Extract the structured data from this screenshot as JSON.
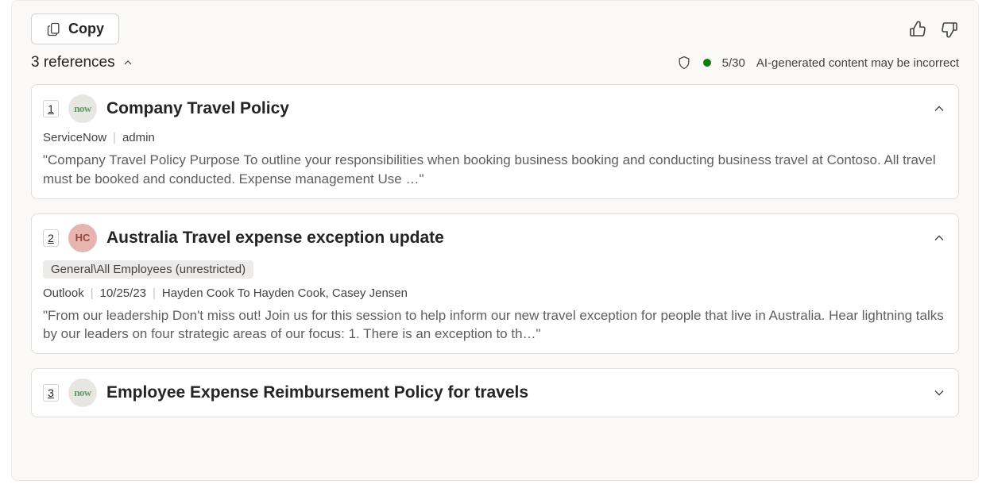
{
  "toolbar": {
    "copy_label": "Copy"
  },
  "references_header": "3 references",
  "status": {
    "count": "5/30",
    "disclaimer": "AI-generated content may be incorrect"
  },
  "references": [
    {
      "index": "1",
      "avatar_kind": "now",
      "avatar_text": "now",
      "title": "Company Travel Policy",
      "expanded": true,
      "source": "ServiceNow",
      "author": "admin",
      "excerpt": "\"Company Travel Policy Purpose To outline your responsibilities when booking business booking and conducting business travel at Contoso. All travel must be booked and conducted. Expense management Use …\""
    },
    {
      "index": "2",
      "avatar_kind": "hc",
      "avatar_text": "HC",
      "title": "Australia Travel expense exception update",
      "expanded": true,
      "tag": "General\\All Employees (unrestricted)",
      "source": "Outlook",
      "date": "10/25/23",
      "author_line": "Hayden Cook To Hayden Cook, Casey Jensen",
      "excerpt": "\"From our leadership Don't miss out! Join us for this session to help inform our new travel exception for people that live in Australia. Hear lightning talks by our leaders on four strategic areas of our focus: 1. There is an exception to th…\""
    },
    {
      "index": "3",
      "avatar_kind": "now",
      "avatar_text": "now",
      "title": "Employee Expense Reimbursement Policy for travels",
      "expanded": false
    }
  ]
}
